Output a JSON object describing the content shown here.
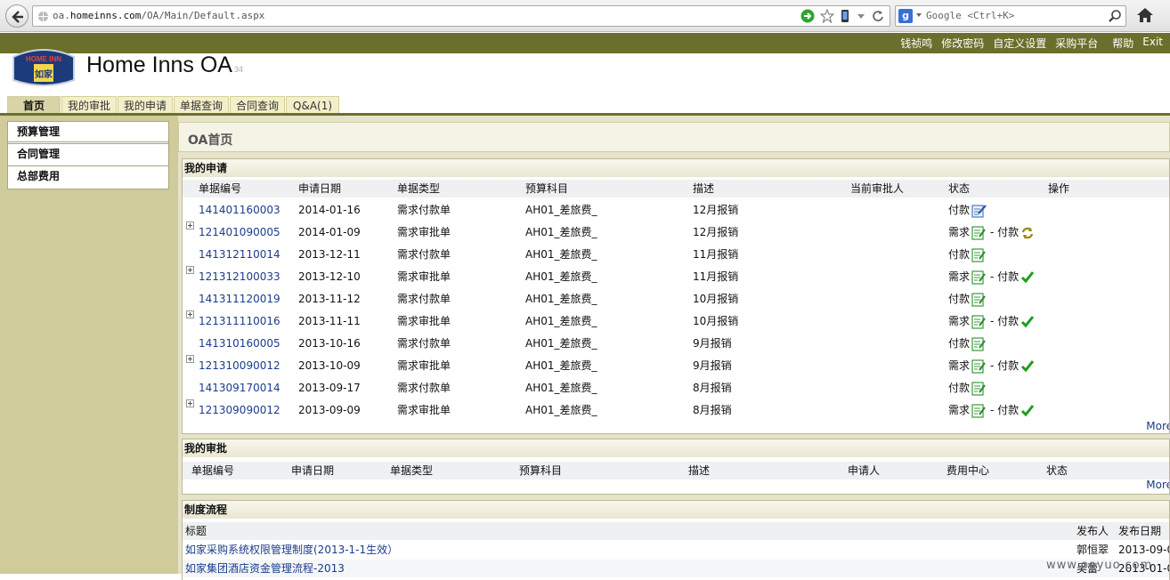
{
  "browser": {
    "url_prefix": "oa.",
    "url_domain": "homeinns.com",
    "url_path": "/OA/Main/Default.aspx",
    "search_placeholder": "Google <Ctrl+K>"
  },
  "header": {
    "top_links": [
      "钱祯鸣",
      "修改密码",
      "自定义设置",
      "采购平台",
      "帮助",
      "Exit"
    ],
    "logo_text_top": "HOME INN",
    "logo_text_chars": "如家",
    "app_title": "Home Inns OA",
    "app_title_suffix": "34"
  },
  "tabs": [
    "首页",
    "我的审批",
    "我的申请",
    "单据查询",
    "合同查询",
    "Q&A(1)"
  ],
  "sidebar": {
    "items": [
      "预算管理",
      "合同管理",
      "总部费用"
    ]
  },
  "main": {
    "page_title": "OA首页",
    "my_applications": {
      "title": "我的申请",
      "columns": [
        "单据编号",
        "申请日期",
        "单据类型",
        "预算科目",
        "描述",
        "当前审批人",
        "状态",
        "操作"
      ],
      "rows": [
        {
          "id": "141401160003",
          "date": "2014-01-16",
          "type": "需求付款单",
          "subject": "AH01_差旅费_",
          "desc": "12月报销",
          "expandable": false,
          "status": "pay_edit"
        },
        {
          "id": "121401090005",
          "date": "2014-01-09",
          "type": "需求审批单",
          "subject": "AH01_差旅费_",
          "desc": "12月报销",
          "expandable": true,
          "status": "req_pay_pending"
        },
        {
          "id": "141312110014",
          "date": "2013-12-11",
          "type": "需求付款单",
          "subject": "AH01_差旅费_",
          "desc": "11月报销",
          "expandable": false,
          "status": "pay_done"
        },
        {
          "id": "121312100033",
          "date": "2013-12-10",
          "type": "需求审批单",
          "subject": "AH01_差旅费_",
          "desc": "11月报销",
          "expandable": true,
          "status": "req_pay_ok"
        },
        {
          "id": "141311120019",
          "date": "2013-11-12",
          "type": "需求付款单",
          "subject": "AH01_差旅费_",
          "desc": "10月报销",
          "expandable": false,
          "status": "pay_done"
        },
        {
          "id": "121311110016",
          "date": "2013-11-11",
          "type": "需求审批单",
          "subject": "AH01_差旅费_",
          "desc": "10月报销",
          "expandable": true,
          "status": "req_pay_ok"
        },
        {
          "id": "141310160005",
          "date": "2013-10-16",
          "type": "需求付款单",
          "subject": "AH01_差旅费_",
          "desc": "9月报销",
          "expandable": false,
          "status": "pay_done"
        },
        {
          "id": "121310090012",
          "date": "2013-10-09",
          "type": "需求审批单",
          "subject": "AH01_差旅费_",
          "desc": "9月报销",
          "expandable": true,
          "status": "req_pay_ok"
        },
        {
          "id": "141309170014",
          "date": "2013-09-17",
          "type": "需求付款单",
          "subject": "AH01_差旅费_",
          "desc": "8月报销",
          "expandable": false,
          "status": "pay_done"
        },
        {
          "id": "121309090012",
          "date": "2013-09-09",
          "type": "需求审批单",
          "subject": "AH01_差旅费_",
          "desc": "8月报销",
          "expandable": true,
          "status": "req_pay_ok"
        }
      ],
      "status_labels": {
        "pay": "付款",
        "req": "需求",
        "dash_pay": "- 付款"
      },
      "more": "More"
    },
    "my_approvals": {
      "title": "我的审批",
      "columns": [
        "单据编号",
        "申请日期",
        "单据类型",
        "预算科目",
        "描述",
        "申请人",
        "费用中心",
        "状态"
      ],
      "more": "More"
    },
    "policies": {
      "title": "制度流程",
      "columns": [
        "标题",
        "发布人",
        "发布日期"
      ],
      "rows": [
        {
          "title": "如家采购系统权限管理制度(2013-1-1生效）",
          "publisher": "郭恒翠",
          "date": "2013-09-0"
        },
        {
          "title": "如家集团酒店资金管理流程-2013",
          "publisher": "吴蕾",
          "date": "2013-01-0"
        }
      ]
    }
  },
  "watermark": "www.ooyuo.com",
  "colors": {
    "olive": "#6c6f2b",
    "sidebar": "#cfcb9a",
    "link": "#1b3c8c",
    "check": "#1aa01a"
  }
}
